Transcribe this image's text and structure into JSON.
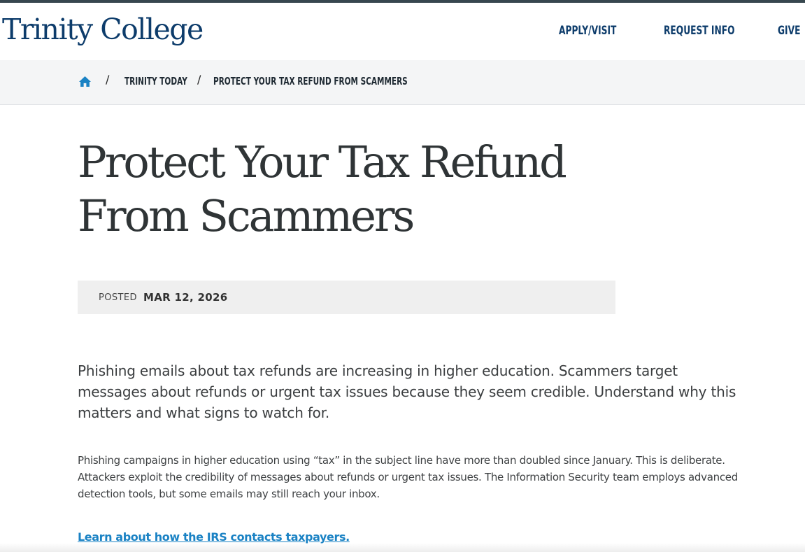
{
  "header": {
    "logo": "Trinity College",
    "nav": [
      "APPLY/VISIT",
      "REQUEST INFO",
      "GIVE"
    ]
  },
  "breadcrumb": {
    "home_icon": "home-icon",
    "separator": "/",
    "items": [
      "TRINITY TODAY",
      "PROTECT YOUR TAX REFUND FROM SCAMMERS"
    ]
  },
  "article": {
    "title_lines": [
      "Protect Your Tax Refund",
      "From Scammers"
    ],
    "posted_label": "POSTED",
    "posted_date": "MAR 12, 2026",
    "intro": "Phishing emails about tax refunds are increasing in higher education. Scammers target messages about refunds or urgent tax issues because they seem credible. Understand why this matters and what signs to watch for.",
    "body": "Phishing campaigns in higher education using “tax” in the subject line have more than doubled since January. This is deliberate. Attackers exploit the credibility of messages about refunds or urgent tax issues. The Information Security team employs advanced detection tools, but some emails may still reach your inbox.",
    "link_text": "Learn about how the IRS contacts taxpayers."
  },
  "colors": {
    "brand_navy": "#0d3c6b",
    "link_blue": "#1a82c4",
    "title_gray": "#2f3436",
    "breadcrumb_bg": "#f4f5f6"
  }
}
